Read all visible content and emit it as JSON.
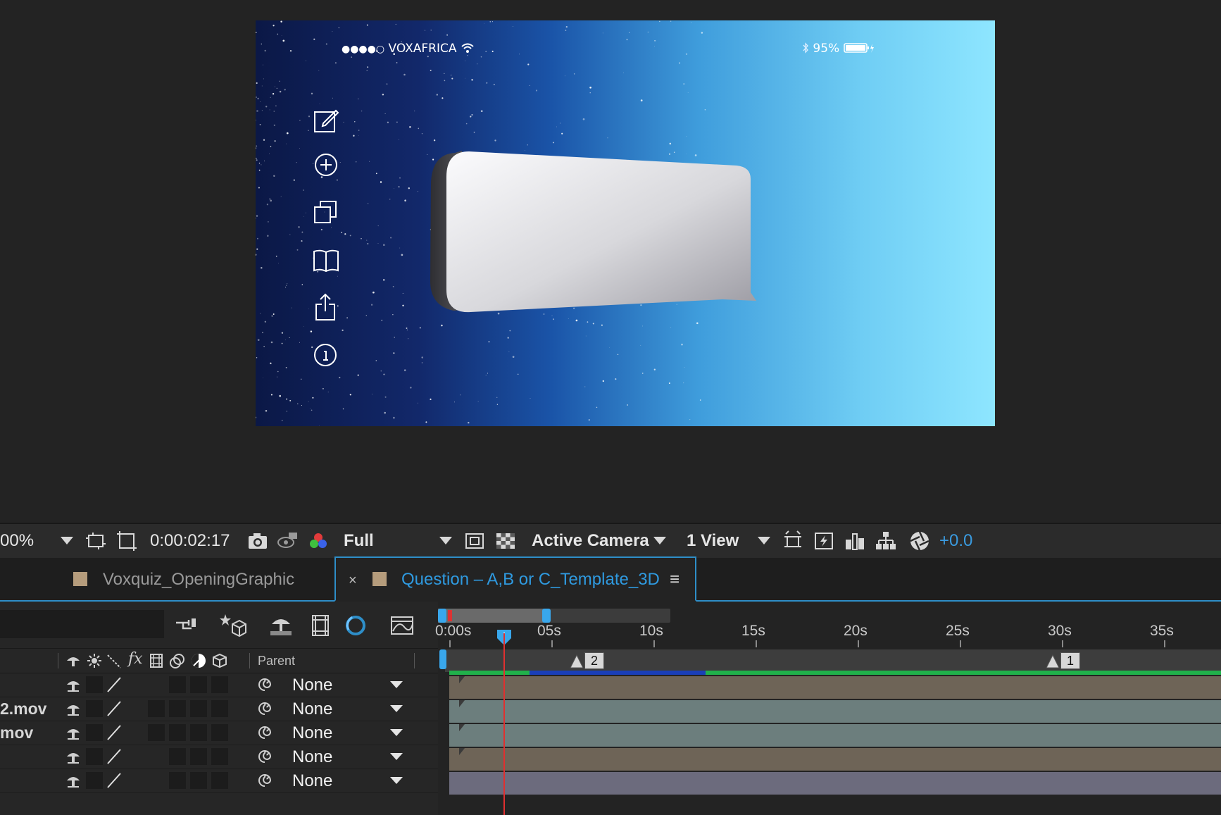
{
  "phone": {
    "carrier_dots": "●●●●○",
    "carrier": "VOXAFRICA",
    "battery": "95%",
    "side_icons": [
      "compose-icon",
      "add-circle-icon",
      "duplicate-icon",
      "book-icon",
      "share-icon",
      "info-icon"
    ]
  },
  "toolbar": {
    "zoom": "00%",
    "timecode": "0:00:02:17",
    "resolution": "Full",
    "camera": "Active Camera",
    "views": "1 View",
    "exposure": "+0.0",
    "exposure_color": "#3a9be0"
  },
  "tabs": [
    {
      "label": "Voxquiz_OpeningGraphic",
      "active": false
    },
    {
      "label": "Question – A,B or C_Template_3D",
      "active": true,
      "close": "×",
      "menu": "≡"
    }
  ],
  "layers": {
    "parent_header": "Parent",
    "rows": [
      {
        "name": "",
        "parent": "None",
        "track_color": "#6e6457"
      },
      {
        "name": "2.mov",
        "parent": "None",
        "track_color": "#6c7e7d"
      },
      {
        "name": "mov",
        "parent": "None",
        "track_color": "#6c7e7d"
      },
      {
        "name": "",
        "parent": "None",
        "track_color": "#6e6457"
      },
      {
        "name": "",
        "parent": "None",
        "track_color": "#6c6b7d"
      }
    ]
  },
  "timeline": {
    "ruler": [
      "0:00s",
      "05s",
      "10s",
      "15s",
      "20s",
      "25s",
      "30s",
      "35s"
    ],
    "markers": [
      "2",
      "1"
    ],
    "current_time_seconds": 2.7
  }
}
